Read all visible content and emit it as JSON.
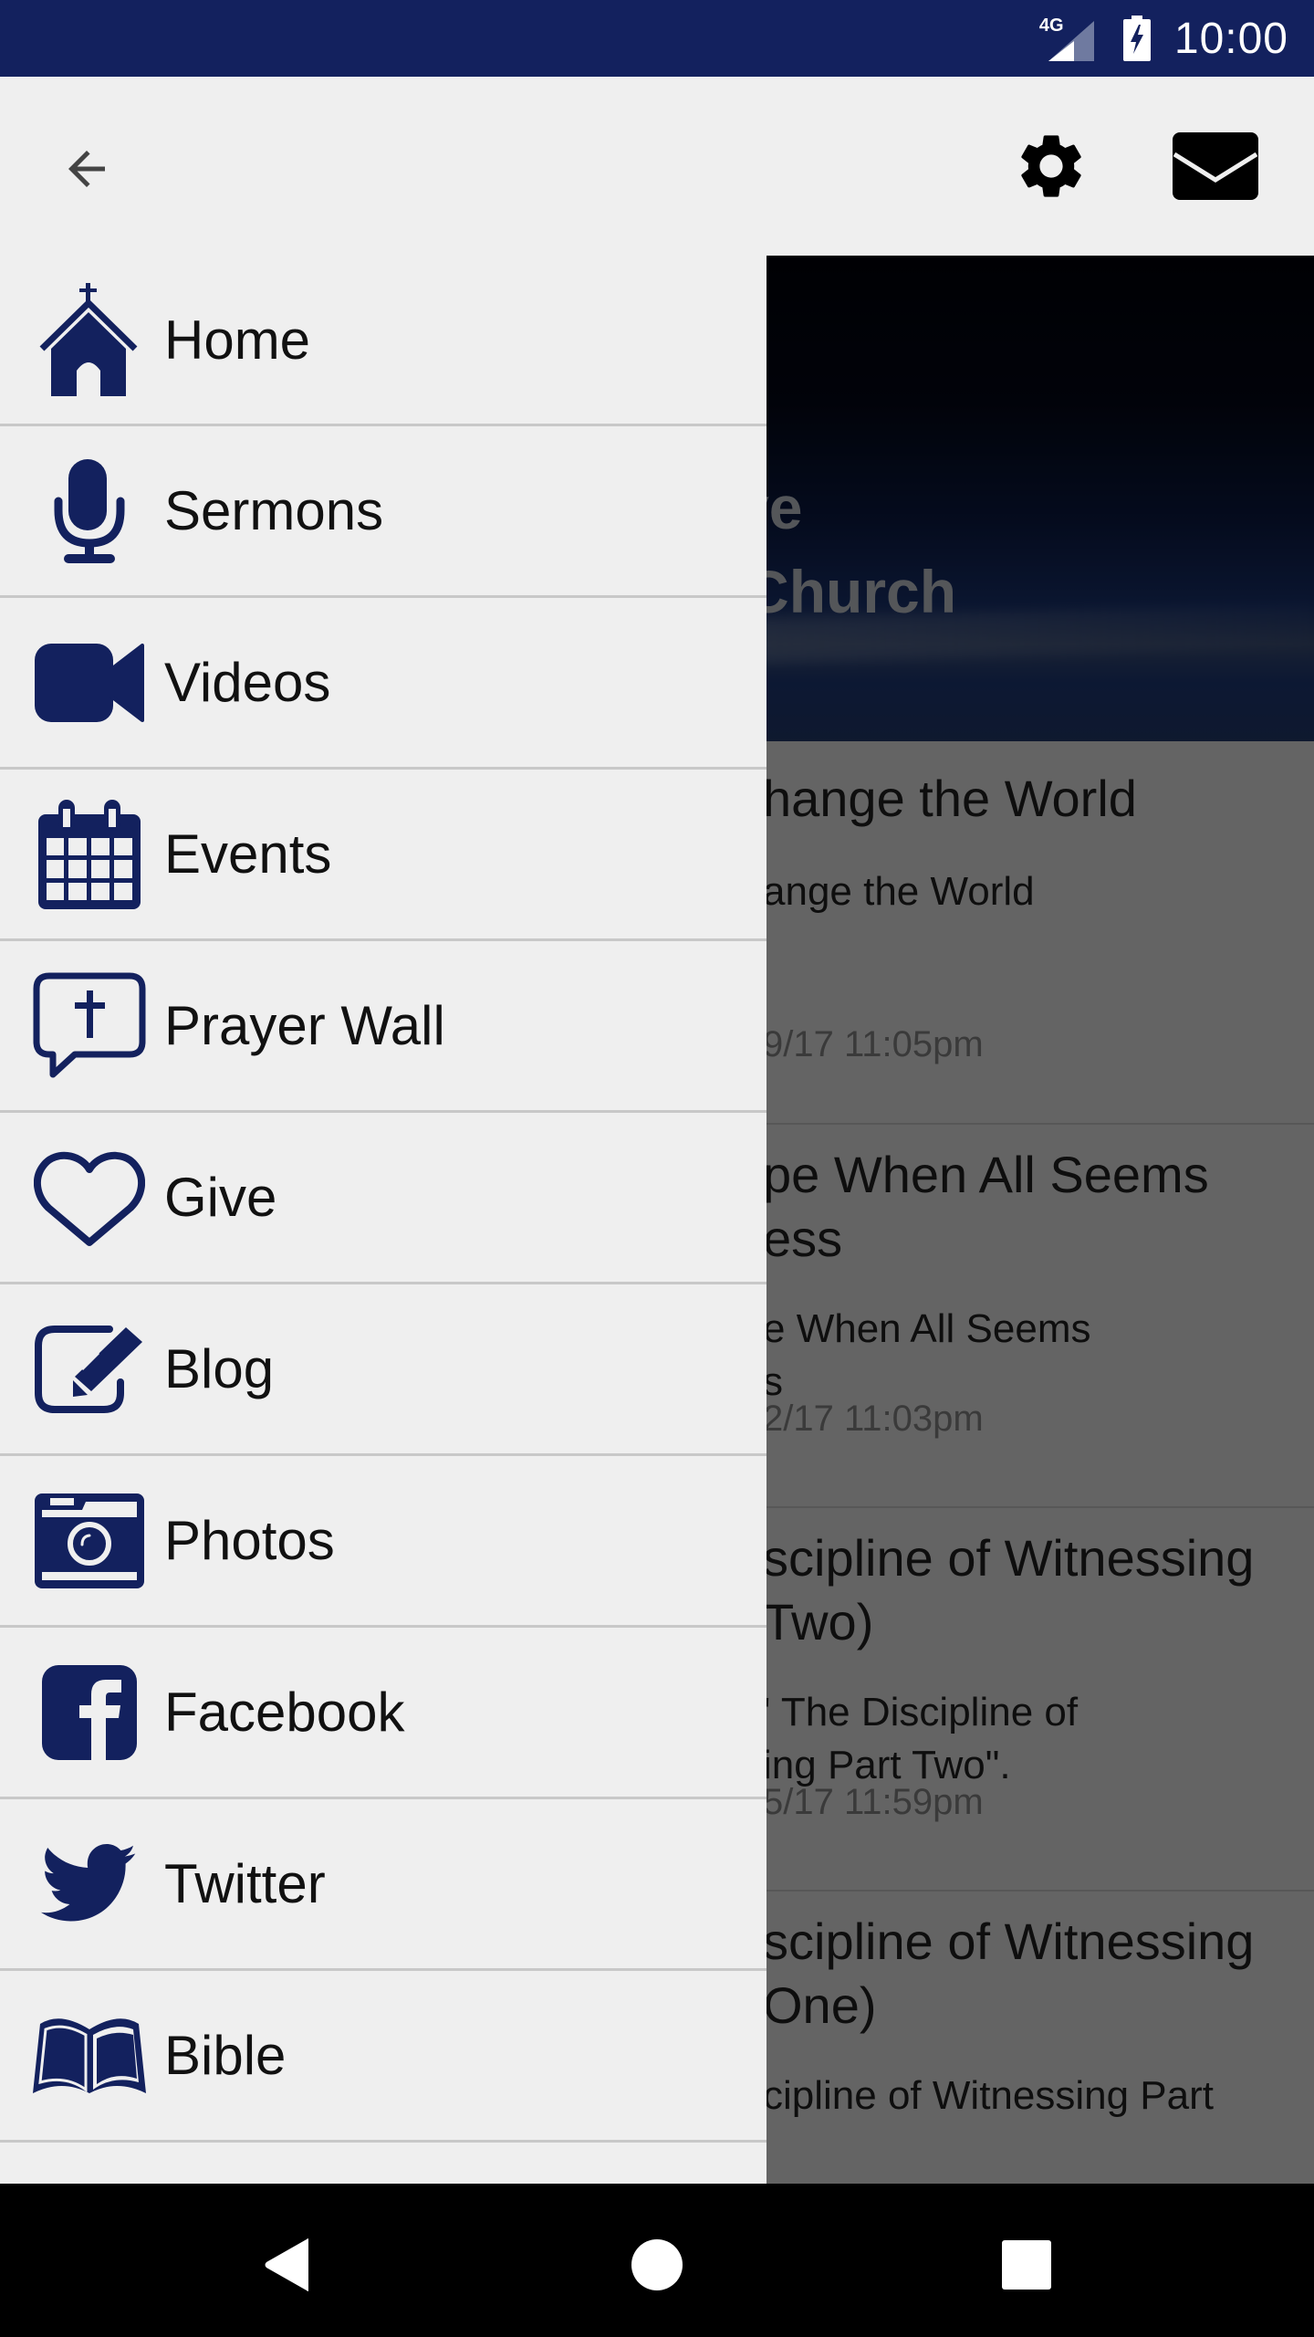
{
  "status_bar": {
    "network": "4G",
    "time": "10:00"
  },
  "toolbar": {
    "back_icon": "arrow-back-icon",
    "settings_icon": "gear-icon",
    "mail_icon": "envelope-icon"
  },
  "background": {
    "banner_title": "hland Drive\nll Baptist Church",
    "feed": [
      {
        "title": "hange the World",
        "description": "ange the World",
        "date": "9/17 11:05pm"
      },
      {
        "title": "pe When All Seems\ness",
        "description": "e When All Seems\ns",
        "date": "2/17 11:03pm"
      },
      {
        "title": "scipline of Witnessing\nTwo)",
        "description": "' The Discipline of\ning Part Two\".",
        "date": "5/17 11:59pm"
      },
      {
        "title": "scipline of Witnessing\nOne)",
        "description": "cipline of Witnessing Part",
        "date": ""
      }
    ]
  },
  "drawer": {
    "accent_color": "#13215e",
    "items": [
      {
        "label": "Home",
        "icon": "church-icon"
      },
      {
        "label": "Sermons",
        "icon": "microphone-icon"
      },
      {
        "label": "Videos",
        "icon": "video-camera-icon"
      },
      {
        "label": "Events",
        "icon": "calendar-icon"
      },
      {
        "label": "Prayer Wall",
        "icon": "prayer-bubble-icon"
      },
      {
        "label": "Give",
        "icon": "heart-icon"
      },
      {
        "label": "Blog",
        "icon": "edit-icon"
      },
      {
        "label": "Photos",
        "icon": "camera-icon"
      },
      {
        "label": "Facebook",
        "icon": "facebook-icon"
      },
      {
        "label": "Twitter",
        "icon": "twitter-icon"
      },
      {
        "label": "Bible",
        "icon": "bible-icon"
      }
    ]
  },
  "nav_bar": {
    "back": "back-icon",
    "home": "home-icon",
    "recents": "recents-icon"
  }
}
